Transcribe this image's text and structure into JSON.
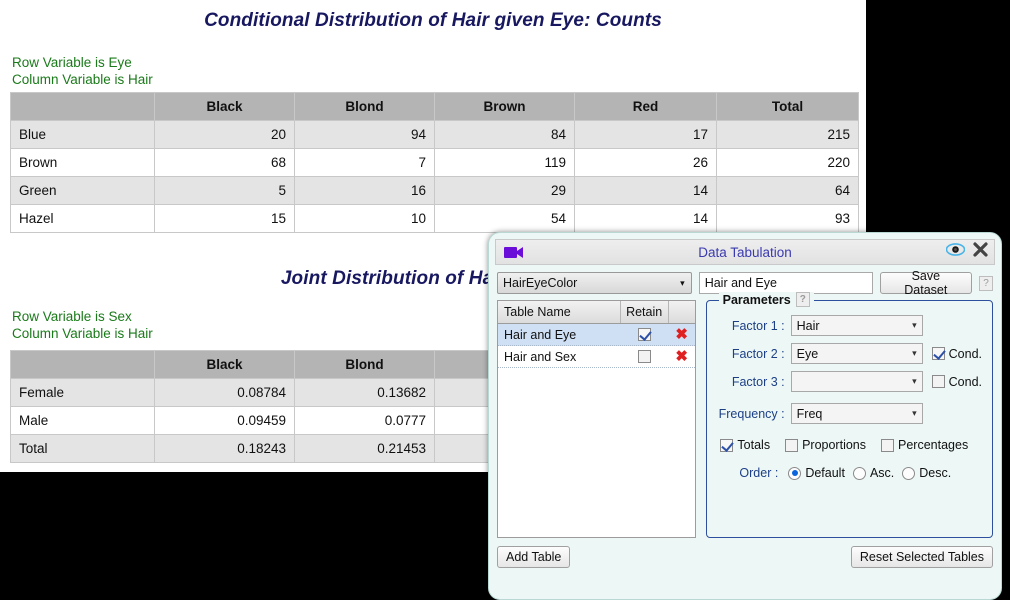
{
  "report": {
    "section1": {
      "title": "Conditional Distribution of Hair given Eye: Counts",
      "row_variable_label": "Row Variable is Eye",
      "column_variable_label": "Column Variable is Hair",
      "columns": [
        "",
        "Black",
        "Blond",
        "Brown",
        "Red",
        "Total"
      ],
      "rows": [
        {
          "label": "Blue",
          "values": [
            "20",
            "94",
            "84",
            "17",
            "215"
          ]
        },
        {
          "label": "Brown",
          "values": [
            "68",
            "7",
            "119",
            "26",
            "220"
          ]
        },
        {
          "label": "Green",
          "values": [
            "5",
            "16",
            "29",
            "14",
            "64"
          ]
        },
        {
          "label": "Hazel",
          "values": [
            "15",
            "10",
            "54",
            "14",
            "93"
          ]
        }
      ]
    },
    "section2": {
      "title": "Joint Distribution of Hair and Sex",
      "row_variable_label": "Row Variable is Sex",
      "column_variable_label": "Column Variable is Hair",
      "columns": [
        "",
        "Black",
        "Blond",
        ""
      ],
      "rows": [
        {
          "label": "Female",
          "values": [
            "0.08784",
            "0.13682",
            ""
          ]
        },
        {
          "label": "Male",
          "values": [
            "0.09459",
            "0.0777",
            ""
          ]
        },
        {
          "label": "Total",
          "values": [
            "0.18243",
            "0.21453",
            ""
          ]
        }
      ]
    }
  },
  "dialog": {
    "title": "Data Tabulation",
    "icons": {
      "app": "video-camera-icon",
      "preview": "eye-icon",
      "close": "close-icon"
    },
    "dataset_select": {
      "value": "HairEyeColor",
      "caret": "▾"
    },
    "table_name_input": {
      "value": "Hair and Eye",
      "placeholder": ""
    },
    "save_dataset_button": "Save Dataset",
    "help_glyph": "?",
    "list": {
      "headers": [
        "Table Name",
        "Retain",
        ""
      ],
      "rows": [
        {
          "name": "Hair and Eye",
          "retain": true,
          "selected": true,
          "delete": "✖"
        },
        {
          "name": "Hair and Sex",
          "retain": false,
          "selected": false,
          "delete": "✖"
        }
      ]
    },
    "parameters": {
      "legend": "Parameters",
      "factor1": {
        "label": "Factor 1 :",
        "value": "Hair"
      },
      "factor2": {
        "label": "Factor 2 :",
        "value": "Eye",
        "cond_label": "Cond.",
        "cond_checked": true
      },
      "factor3": {
        "label": "Factor 3 :",
        "value": "",
        "cond_label": "Cond.",
        "cond_checked": false
      },
      "frequency": {
        "label": "Frequency :",
        "value": "Freq"
      },
      "toggles": [
        {
          "label": "Totals",
          "checked": true
        },
        {
          "label": "Proportions",
          "checked": false
        },
        {
          "label": "Percentages",
          "checked": false
        }
      ],
      "order": {
        "label": "Order :",
        "options": [
          {
            "label": "Default",
            "selected": true
          },
          {
            "label": "Asc.",
            "selected": false
          },
          {
            "label": "Desc.",
            "selected": false
          }
        ]
      }
    },
    "add_table_button": "Add Table",
    "reset_button": "Reset Selected Tables"
  },
  "colors": {
    "title_navy": "#181860",
    "label_green": "#1a7a1a",
    "dialog_bg": "#edf8f6",
    "header_grey": "#b4b4b4",
    "row_grey": "#e4e4e4",
    "accent_blue": "#2d4f9e",
    "delete_red": "#e02020",
    "cam_purple": "#6a0dd8"
  }
}
